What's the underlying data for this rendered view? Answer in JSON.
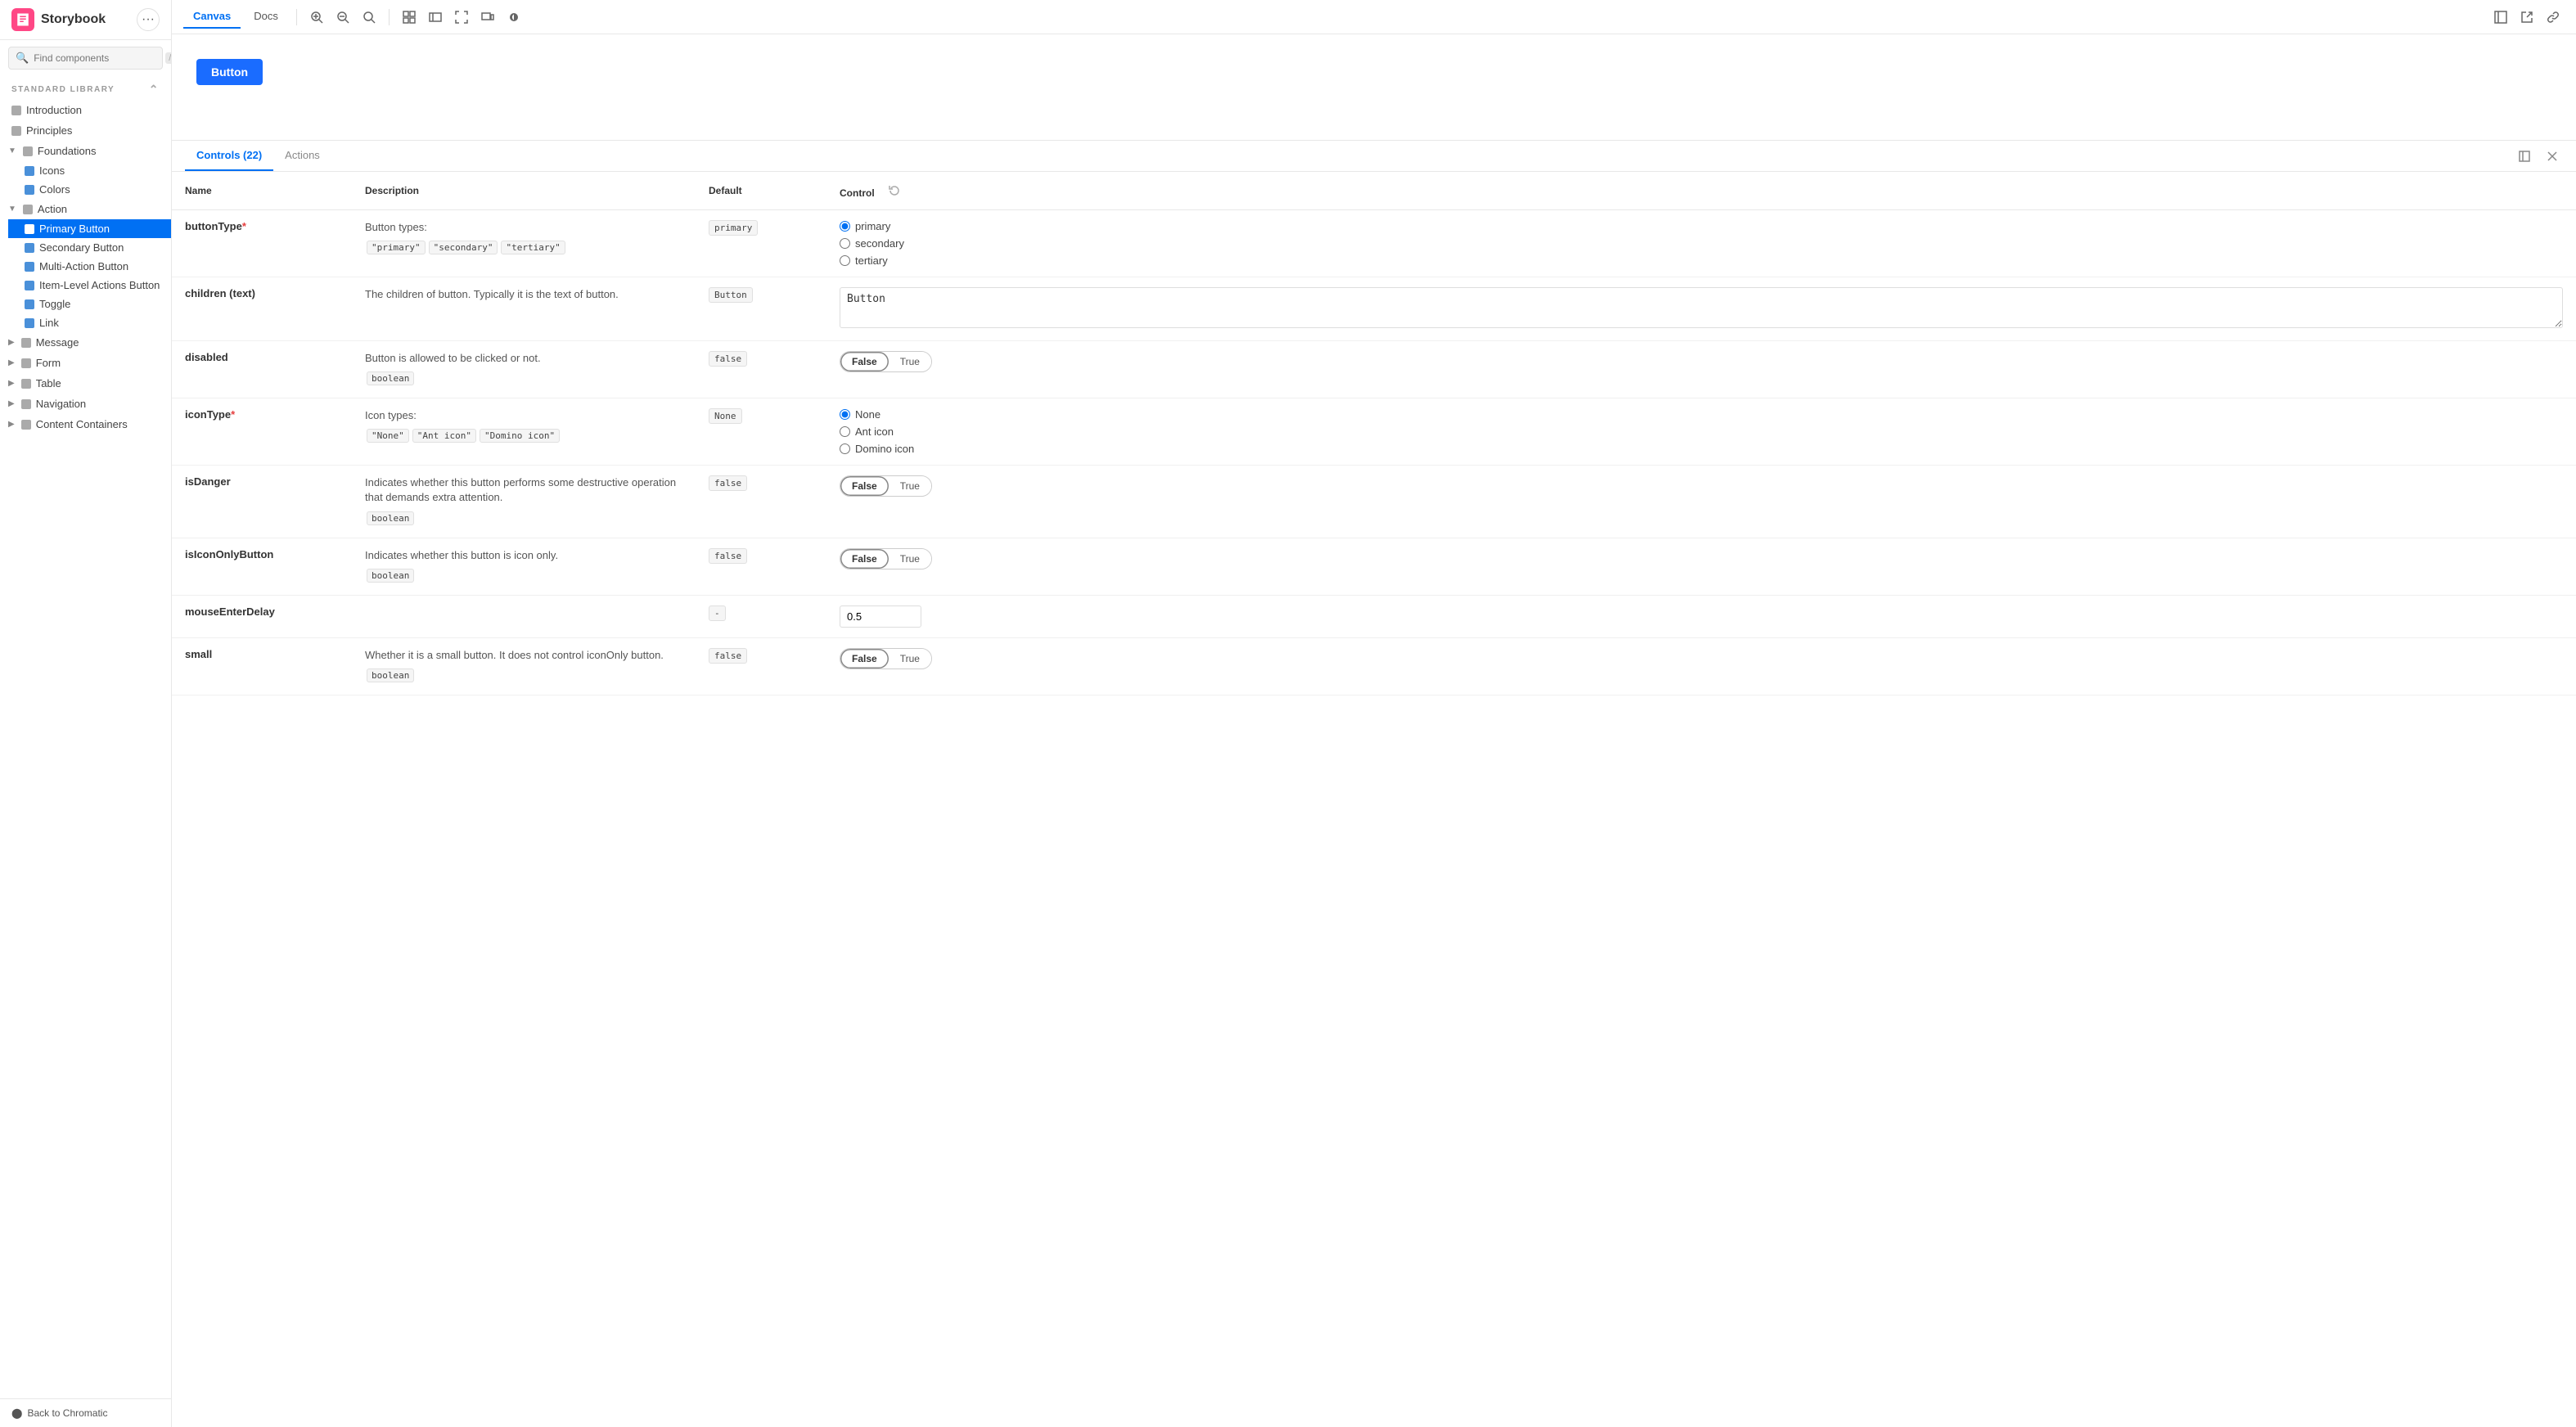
{
  "app": {
    "name": "Storybook"
  },
  "sidebar": {
    "search_placeholder": "Find components",
    "search_shortcut": "/",
    "section_label": "STANDARD LIBRARY",
    "nav": [
      {
        "id": "introduction",
        "label": "Introduction",
        "type": "item",
        "icon": "square"
      },
      {
        "id": "principles",
        "label": "Principles",
        "type": "item",
        "icon": "square"
      },
      {
        "id": "foundations",
        "label": "Foundations",
        "type": "group",
        "expanded": true,
        "children": [
          {
            "id": "icons",
            "label": "Icons"
          },
          {
            "id": "colors",
            "label": "Colors"
          }
        ]
      },
      {
        "id": "action",
        "label": "Action",
        "type": "group",
        "expanded": true,
        "children": [
          {
            "id": "primary-button",
            "label": "Primary Button",
            "active": true
          },
          {
            "id": "secondary-button",
            "label": "Secondary Button"
          },
          {
            "id": "multi-action-button",
            "label": "Multi-Action Button"
          },
          {
            "id": "item-level-actions-button",
            "label": "Item-Level Actions Button"
          },
          {
            "id": "toggle",
            "label": "Toggle"
          },
          {
            "id": "link",
            "label": "Link"
          }
        ]
      },
      {
        "id": "message",
        "label": "Message",
        "type": "group",
        "expanded": false
      },
      {
        "id": "form",
        "label": "Form",
        "type": "group",
        "expanded": false
      },
      {
        "id": "table",
        "label": "Table",
        "type": "group",
        "expanded": false
      },
      {
        "id": "navigation",
        "label": "Navigation",
        "type": "group",
        "expanded": false
      },
      {
        "id": "content-containers",
        "label": "Content Containers",
        "type": "group",
        "expanded": false
      }
    ],
    "back_label": "Back to Chromatic"
  },
  "toolbar": {
    "tabs": [
      {
        "id": "canvas",
        "label": "Canvas",
        "active": true
      },
      {
        "id": "docs",
        "label": "Docs",
        "active": false
      }
    ]
  },
  "canvas": {
    "preview_button_label": "Button"
  },
  "controls": {
    "tab_label": "Controls (22)",
    "actions_label": "Actions",
    "columns": {
      "name": "Name",
      "description": "Description",
      "default": "Default",
      "control": "Control"
    },
    "rows": [
      {
        "name": "buttonType",
        "required": true,
        "description": "Button types:",
        "code_values": [
          "\"primary\"",
          "\"secondary\"",
          "\"tertiary\""
        ],
        "default": "primary",
        "control_type": "radio",
        "options": [
          "primary",
          "secondary",
          "tertiary"
        ],
        "selected": "primary"
      },
      {
        "name": "children (text)",
        "required": false,
        "description": "The children of button. Typically it is the text of button.",
        "code_values": [],
        "default": "Button",
        "control_type": "textarea",
        "value": "Button"
      },
      {
        "name": "disabled",
        "required": false,
        "description": "Button is allowed to be clicked or not.",
        "code_values": [
          "boolean"
        ],
        "default": "false",
        "control_type": "toggle",
        "options": [
          "False",
          "True"
        ],
        "selected": "False"
      },
      {
        "name": "iconType",
        "required": true,
        "description": "Icon types:",
        "code_values": [
          "\"None\"",
          "\"Ant icon\"",
          "\"Domino icon\""
        ],
        "default": "None",
        "control_type": "radio",
        "options": [
          "None",
          "Ant icon",
          "Domino icon"
        ],
        "selected": "None"
      },
      {
        "name": "isDanger",
        "required": false,
        "description": "Indicates whether this button performs some destructive operation that demands extra attention.",
        "code_values": [
          "boolean"
        ],
        "default": "false",
        "control_type": "toggle",
        "options": [
          "False",
          "True"
        ],
        "selected": "False"
      },
      {
        "name": "isIconOnlyButton",
        "required": false,
        "description": "Indicates whether this button is icon only.",
        "code_values": [
          "boolean"
        ],
        "default": "false",
        "control_type": "toggle",
        "options": [
          "False",
          "True"
        ],
        "selected": "False"
      },
      {
        "name": "mouseEnterDelay",
        "required": false,
        "description": "",
        "code_values": [],
        "default": "-",
        "control_type": "number",
        "value": "0.5"
      },
      {
        "name": "small",
        "required": false,
        "description": "Whether it is a small button. It does not control iconOnly button.",
        "code_values": [
          "boolean"
        ],
        "default": "false",
        "control_type": "toggle",
        "options": [
          "False",
          "True"
        ],
        "selected": "False"
      }
    ]
  }
}
